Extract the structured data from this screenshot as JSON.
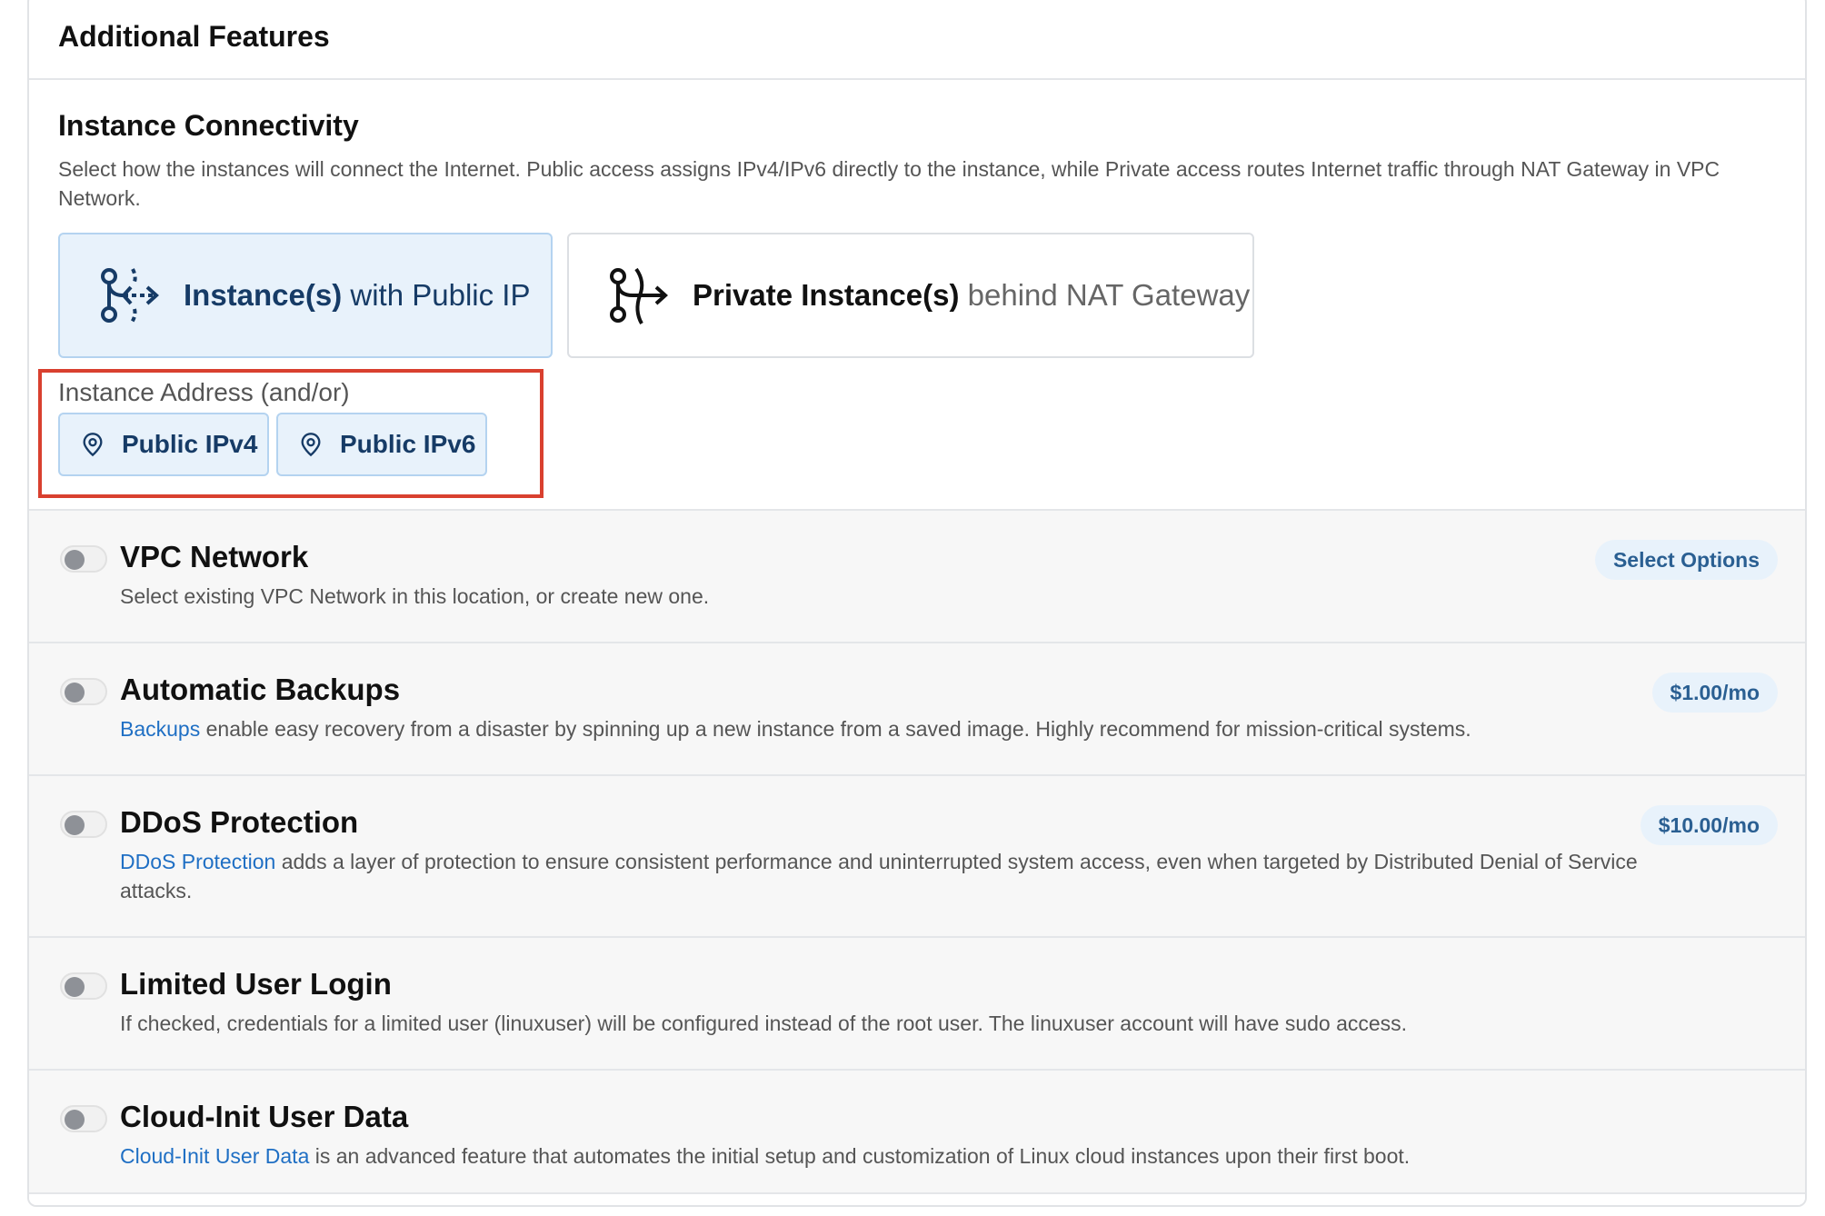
{
  "panel": {
    "title": "Additional Features"
  },
  "connectivity": {
    "title": "Instance Connectivity",
    "description": "Select how the instances will connect the Internet. Public access assigns IPv4/IPv6 directly to the instance, while Private access routes Internet traffic through NAT Gateway in VPC Network.",
    "public_option": {
      "bold": "Instance(s)",
      "rest": " with Public IP",
      "selected": true,
      "icon": "public-ip-branch-icon"
    },
    "private_option": {
      "bold": "Private Instance(s)",
      "rest": " behind NAT Gateway",
      "selected": false,
      "icon": "nat-gateway-branch-icon"
    },
    "address": {
      "label": "Instance Address (and/or)",
      "options": [
        {
          "label": "Public IPv4",
          "icon": "location-pin-icon"
        },
        {
          "label": "Public IPv6",
          "icon": "location-pin-icon"
        }
      ]
    }
  },
  "features": [
    {
      "title": "VPC Network",
      "desc_link": "",
      "desc": "Select existing VPC Network in this location, or create new one.",
      "badge": "Select Options",
      "enabled": false
    },
    {
      "title": "Automatic Backups",
      "desc_link": "Backups",
      "desc": " enable easy recovery from a disaster by spinning up a new instance from a saved image. Highly recommend for mission-critical systems.",
      "badge": "$1.00/mo",
      "enabled": false
    },
    {
      "title": "DDoS Protection",
      "desc_link": "DDoS Protection",
      "desc": " adds a layer of protection to ensure consistent performance and uninterrupted system access, even when targeted by Distributed Denial of Service attacks.",
      "badge": "$10.00/mo",
      "enabled": false
    },
    {
      "title": "Limited User Login",
      "desc_link": "",
      "desc": "If checked, credentials for a limited user (linuxuser) will be configured instead of the root user. The linuxuser account will have sudo access.",
      "badge": "",
      "enabled": false
    },
    {
      "title": "Cloud-Init User Data",
      "desc_link": "Cloud-Init User Data",
      "desc": " is an advanced feature that automates the initial setup and customization of Linux cloud instances upon their first boot.",
      "badge": "",
      "enabled": false
    }
  ],
  "colors": {
    "accent": "#1f6fc4",
    "selected_bg": "#e8f2fb",
    "highlight_border": "#d9402f"
  }
}
